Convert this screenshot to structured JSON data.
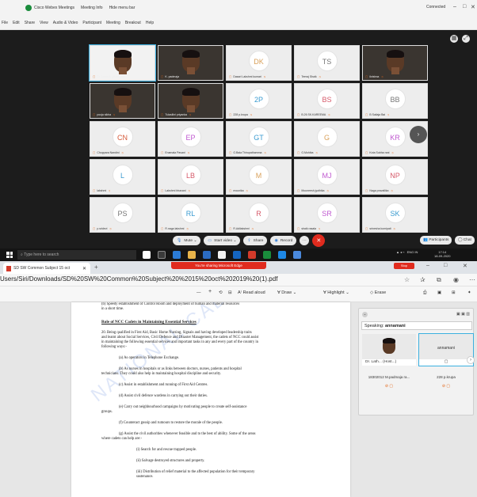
{
  "webex": {
    "title_menus": [
      "Cisco Webex Meetings",
      "Meeting Info",
      "Hide menu bar"
    ],
    "connection": "Connected",
    "menu": [
      "File",
      "Edit",
      "Share",
      "View",
      "Audio & Video",
      "Participant",
      "Meeting",
      "Breakout",
      "Help"
    ],
    "tiles": [
      {
        "name": "Dr. Latha A. (Host, me)",
        "avatar": "",
        "kind": "photo"
      },
      {
        "name": "K. padmaja",
        "avatar": "",
        "kind": "photo"
      },
      {
        "name": "Dasari Lakshmi kumari",
        "avatar": "DK",
        "kind": "initials",
        "color": "#d9a15b"
      },
      {
        "name": "Teeraj Shaik",
        "avatar": "TS",
        "kind": "initials",
        "color": "#777777"
      },
      {
        "name": "ikrishna",
        "avatar": "",
        "kind": "photo"
      },
      {
        "name": "pooja sikha",
        "avatar": "",
        "kind": "photo"
      },
      {
        "name": "Tulasilini priyanka",
        "avatar": "",
        "kind": "photo"
      },
      {
        "name": "228 p.krupa",
        "avatar": "2P",
        "kind": "initials",
        "color": "#3a9bd0"
      },
      {
        "name": "B.26 SK.KAREEMA",
        "avatar": "BS",
        "kind": "initials",
        "color": "#d65a6a"
      },
      {
        "name": "B Sailaja Bai",
        "avatar": "BB",
        "kind": "initials",
        "color": "#777777"
      },
      {
        "name": "Choppara Nandini",
        "avatar": "CN",
        "kind": "initials",
        "color": "#d65a3a"
      },
      {
        "name": "Enamala Pavani",
        "avatar": "EP",
        "kind": "initials",
        "color": "#c05ad0"
      },
      {
        "name": "G.Bala Thirupathamma",
        "avatar": "GT",
        "kind": "initials",
        "color": "#3a9bd0"
      },
      {
        "name": "G.Mohiba",
        "avatar": "G",
        "kind": "initials",
        "color": "#d9a15b"
      },
      {
        "name": "Kota Subha rani",
        "avatar": "KR",
        "kind": "initials",
        "color": "#c05ad0"
      },
      {
        "name": "lakshmi",
        "avatar": "L",
        "kind": "initials",
        "color": "#3a9bd0"
      },
      {
        "name": "Lakshmi bhavani",
        "avatar": "LB",
        "kind": "initials",
        "color": "#d65a6a"
      },
      {
        "name": "mounika",
        "avatar": "M",
        "kind": "initials",
        "color": "#d9a15b"
      },
      {
        "name": "Mouneesh jyothika",
        "avatar": "MJ",
        "kind": "initials",
        "color": "#c05ad0"
      },
      {
        "name": "Naga pravallika",
        "avatar": "NP",
        "kind": "initials",
        "color": "#d65a6a"
      },
      {
        "name": "p.sridevi",
        "avatar": "PS",
        "kind": "initials",
        "color": "#777777"
      },
      {
        "name": "R.naga lakshmi",
        "avatar": "RL",
        "kind": "initials",
        "color": "#3a9bd0"
      },
      {
        "name": "R.Adilakshmi",
        "avatar": "R",
        "kind": "initials",
        "color": "#d65a6a"
      },
      {
        "name": "shaik rasala",
        "avatar": "SR",
        "kind": "initials",
        "color": "#c05ad0"
      },
      {
        "name": "srinesha komipati",
        "avatar": "SK",
        "kind": "initials",
        "color": "#3a9bd0"
      }
    ],
    "controls": {
      "mute": "Mute",
      "start_video": "Start video",
      "share": "Share",
      "record": "Record",
      "participants": "Participants",
      "chat": "Chat"
    }
  },
  "taskbar": {
    "search_placeholder": "Type here to search",
    "lang": "ENG",
    "region": "IN",
    "time": "17:14",
    "date": "18-09-2020"
  },
  "browser": {
    "tab_title": "SD SW Common Subject 15 oct",
    "sharing_banner": "You're sharing Microsoft Edge",
    "stop_label": "Stop",
    "url": "Users/Siri/Downloads/SD%20SW%20Common%20Subject%20%2015%20oct%202019%20(1).pdf",
    "pdf_toolbar": {
      "zoom_out": "—",
      "zoom_in": "+",
      "read_aloud": "Read aloud",
      "draw": "Draw",
      "highlight": "Highlight",
      "erase": "Erase"
    }
  },
  "pdf": {
    "lines": [
      "(b)       Speedy establishment of Control Room and deployment of human and material resources",
      "in a short time.",
      "Role of NCC Cadets in Maintaining Essential Services",
      "20.      Being qualified in First Aid, Basic Home Nursing, Signals and having developed leadership traits",
      "and learnt about Social Services, Civil Defence and Disaster Management, the cadets of NCC could assist",
      "in maintaining the following essential services and important tasks in any and every part of the country in",
      "following ways:-",
      "(a)       As operators in Telephone Exchange.",
      "(b)       As nurses in hospitals or as links between doctors, nurses, patients and hospital",
      "technicians. They could also help in maintaining hospital discipline and security.",
      "(c)       Assist in establishment and running of First Aid Centres.",
      "(d)       Assist civil defence wardens in carrying out their duties.",
      "(e)       Carry out neighbourhood campaigns by motivating people to create self-assistance",
      "groups.",
      "(f)       Counteract gossip and rumours to restore the morale of the people.",
      "(g)       Assist the civil authorities whenever feasible and to the best of ability. Some of the areas",
      "where cadets can help are:-",
      "(i)        Search for and rescue trapped people.",
      "(ii)       Salvage destroyed structures and property.",
      "(iii)      Distribution of relief material to the affected population for their temporary",
      "sustenance."
    ],
    "watermark": "NATIONAL CADET CORPS"
  },
  "float_panel": {
    "speaking_label": "Speaking:",
    "speaking_name": "annamani",
    "video_left_name": "Dr. Lath... (Host...)",
    "video_right_name": "annamani",
    "p1_name": "18302012 M.padmaja ra...",
    "p2_name": "228 p.krupa"
  }
}
